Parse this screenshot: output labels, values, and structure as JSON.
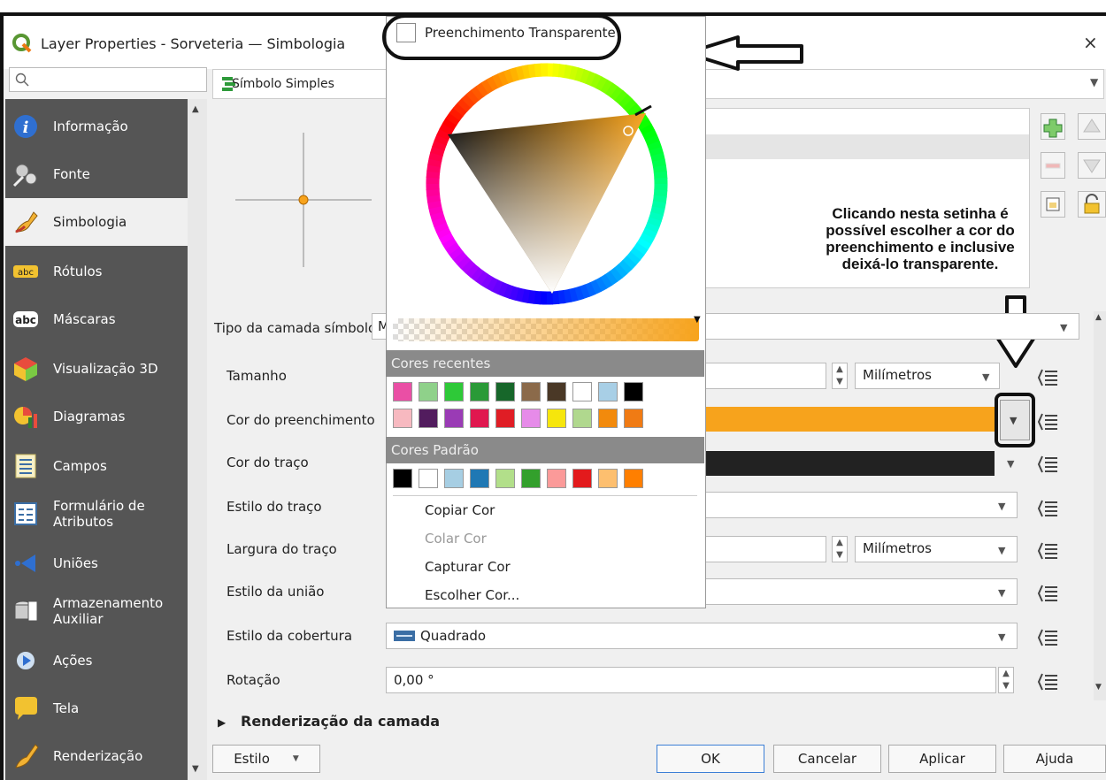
{
  "window": {
    "title": "Layer Properties - Sorveteria — Simbologia",
    "close_label": "×"
  },
  "sidebar": {
    "search_placeholder": "",
    "items": [
      {
        "label": "Informação",
        "icon": "info-icon"
      },
      {
        "label": "Fonte",
        "icon": "source-icon"
      },
      {
        "label": "Simbologia",
        "icon": "paintbrush-icon",
        "active": true
      },
      {
        "label": "Rótulos",
        "icon": "abc-label-icon"
      },
      {
        "label": "Máscaras",
        "icon": "abc-mask-icon"
      },
      {
        "label": "Visualização 3D",
        "icon": "cube-3d-icon"
      },
      {
        "label": "Diagramas",
        "icon": "diagram-icon"
      },
      {
        "label": "Campos",
        "icon": "fields-icon"
      },
      {
        "label": "Formulário de Atributos",
        "icon": "form-icon"
      },
      {
        "label": "Uniões",
        "icon": "join-icon"
      },
      {
        "label": "Armazenamento Auxiliar",
        "icon": "storage-icon"
      },
      {
        "label": "Ações",
        "icon": "actions-icon"
      },
      {
        "label": "Tela",
        "icon": "display-icon"
      },
      {
        "label": "Renderização",
        "icon": "render-icon"
      }
    ]
  },
  "symbol": {
    "type_label": "Símbolo Simples"
  },
  "annotation": {
    "note": "Clicando nesta setinha é possível escolher a cor do preenchimento e inclusive deixá-lo transparente."
  },
  "form": {
    "layer_type_label": "Tipo da camada símbolo",
    "layer_type_value_partial": "M",
    "rows": {
      "size": {
        "label": "Tamanho",
        "unit": "Milímetros"
      },
      "fill_color": {
        "label": "Cor do preenchimento",
        "color": "#f7a31c"
      },
      "stroke_color": {
        "label": "Cor do traço",
        "color": "#222222"
      },
      "stroke_style": {
        "label": "Estilo do traço"
      },
      "stroke_width": {
        "label": "Largura do traço",
        "unit": "Milímetros"
      },
      "join_style": {
        "label": "Estilo da união"
      },
      "cap_style": {
        "label": "Estilo da cobertura",
        "value": "Quadrado"
      },
      "rotation": {
        "label": "Rotação",
        "value": "0,00 °"
      }
    },
    "layer_rendering": "Renderização da camada"
  },
  "color_popup": {
    "transparent_label": "Preenchimento Transparente",
    "recent_title": "Cores recentes",
    "recent_colors": [
      "#ea4fa5",
      "#8fd18a",
      "#2ec938",
      "#2a9a37",
      "#17672a",
      "#8b6a4a",
      "#4a3826",
      "#ffffff",
      "#a8cfe6",
      "#000000",
      "#f7b9c0",
      "#521c5e",
      "#9a3bb5",
      "#e0174f",
      "#e01d25",
      "#e68be9",
      "#f6e60c",
      "#b0d88e",
      "#f28a0c",
      "#f07b14"
    ],
    "default_title": "Cores Padrão",
    "default_colors": [
      "#000000",
      "#ffffff",
      "#a6cee3",
      "#1f78b4",
      "#b2df8a",
      "#33a02c",
      "#fb9a99",
      "#e31a1c",
      "#fdbf6f",
      "#ff7f00"
    ],
    "menu": [
      {
        "label": "Copiar Cor",
        "enabled": true
      },
      {
        "label": "Colar Cor",
        "enabled": false
      },
      {
        "label": "Capturar Cor",
        "enabled": true
      },
      {
        "label": "Escolher Cor...",
        "enabled": true
      }
    ],
    "current_color": "#f7a31c"
  },
  "footer": {
    "style_button": "Estilo",
    "ok": "OK",
    "cancel": "Cancelar",
    "apply": "Aplicar",
    "help": "Ajuda"
  }
}
